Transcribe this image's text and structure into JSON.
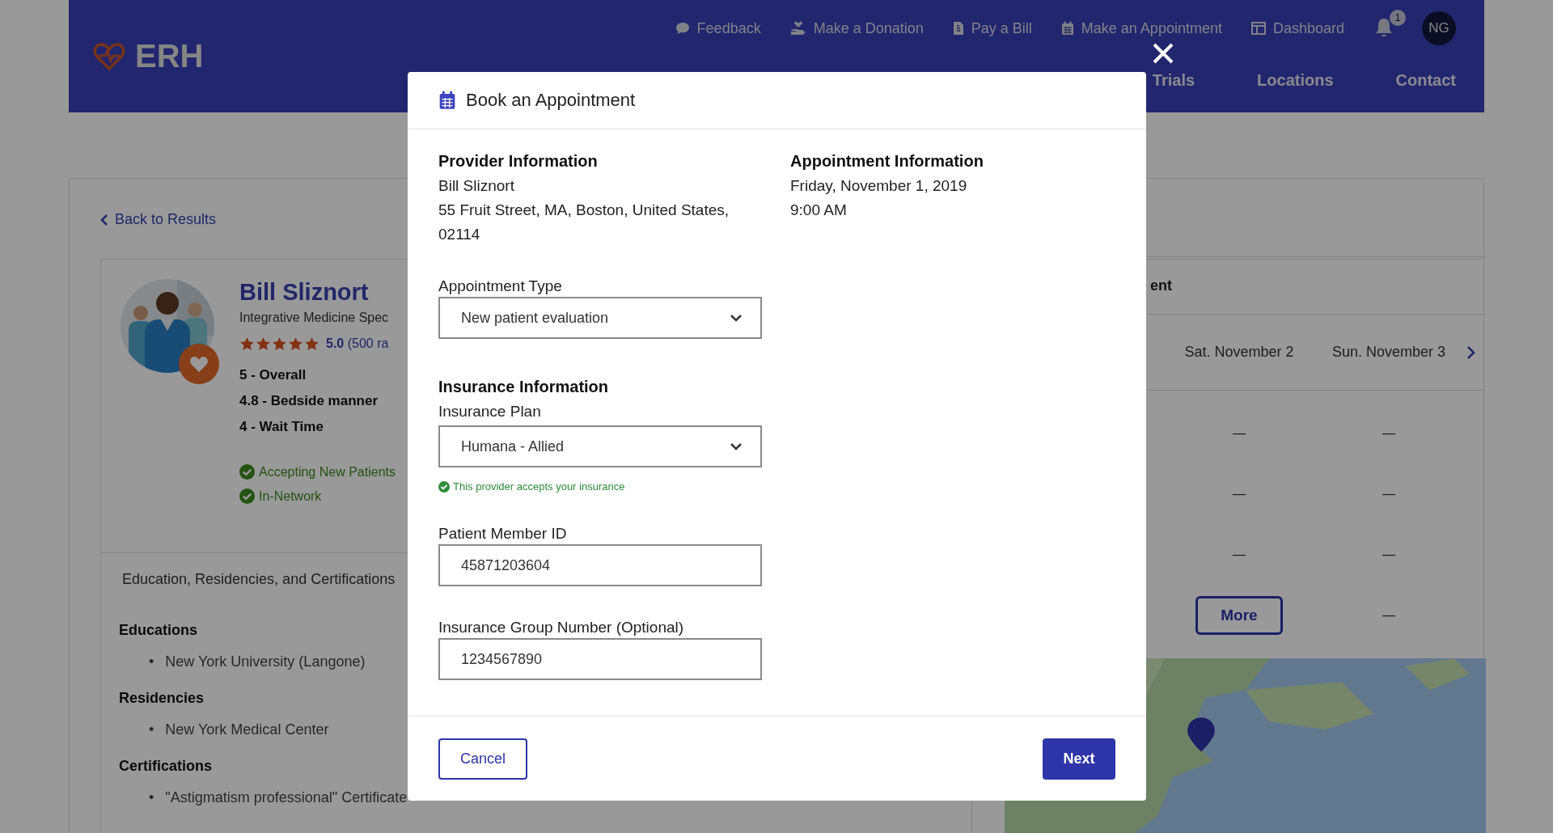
{
  "header": {
    "logo": "ERH",
    "top_links": [
      {
        "kind": "chat",
        "label": "Feedback"
      },
      {
        "kind": "donation",
        "label": "Make a Donation"
      },
      {
        "kind": "bill",
        "label": "Pay a Bill"
      },
      {
        "kind": "calendar",
        "label": "Make an Appointment"
      },
      {
        "kind": "dashboard",
        "label": "Dashboard"
      }
    ],
    "notification_count": "1",
    "avatar_initials": "NG",
    "main_nav": [
      "Trials",
      "Locations",
      "Contact"
    ]
  },
  "back_link": "Back to Results",
  "provider": {
    "name": "Bill Sliznort",
    "specialty": "Integrative Medicine Spec",
    "stars": 5,
    "rating": "5.0",
    "rating_count": "(500 ra",
    "scores": [
      "5 - Overall",
      "4.8 - Bedside manner",
      "4 - Wait Time"
    ],
    "badges": [
      "Accepting New Patients",
      "In-Network"
    ]
  },
  "details_bullet": "•",
  "details_tab": "Education, Residencies, and Certifications",
  "details": [
    {
      "heading": "Educations",
      "items": [
        "New York University (Langone)"
      ]
    },
    {
      "heading": "Residencies",
      "items": [
        "New York Medical Center"
      ]
    },
    {
      "heading": "Certifications",
      "items": [
        "\"Astigmatism professional\" Certificate"
      ]
    }
  ],
  "schedule": {
    "heading": "ent",
    "days": [
      {
        "label": "Sat. November 2",
        "slots": [
          {
            "kind": "empty",
            "text": "—"
          },
          {
            "kind": "empty",
            "text": "—"
          },
          {
            "kind": "empty",
            "text": "—"
          },
          {
            "kind": "button",
            "text": "More"
          }
        ]
      },
      {
        "label": "Sun. November 3",
        "slots": [
          {
            "kind": "empty",
            "text": "—"
          },
          {
            "kind": "empty",
            "text": "—"
          },
          {
            "kind": "empty",
            "text": "—"
          },
          {
            "kind": "empty",
            "text": "—"
          }
        ]
      }
    ]
  },
  "modal": {
    "title": "Book an Appointment",
    "provider_info": {
      "heading": "Provider Information",
      "lines": [
        "Bill Sliznort",
        "55 Fruit Street, MA, Boston, United States, 02114"
      ]
    },
    "appointment_info": {
      "heading": "Appointment Information",
      "lines": [
        "Friday, November 1, 2019",
        "9:00 AM"
      ]
    },
    "appointment_type": {
      "label": "Appointment Type",
      "value": "New patient evaluation"
    },
    "insurance": {
      "heading": "Insurance Information",
      "label": "Insurance Plan",
      "value": "Humana - Allied",
      "note": "This provider accepts your insurance"
    },
    "member_id": {
      "label": "Patient Member ID",
      "value": "45871203604"
    },
    "group_number": {
      "label": "Insurance Group Number (Optional)",
      "value": "1234567890"
    },
    "cancel": "Cancel",
    "next": "Next"
  }
}
